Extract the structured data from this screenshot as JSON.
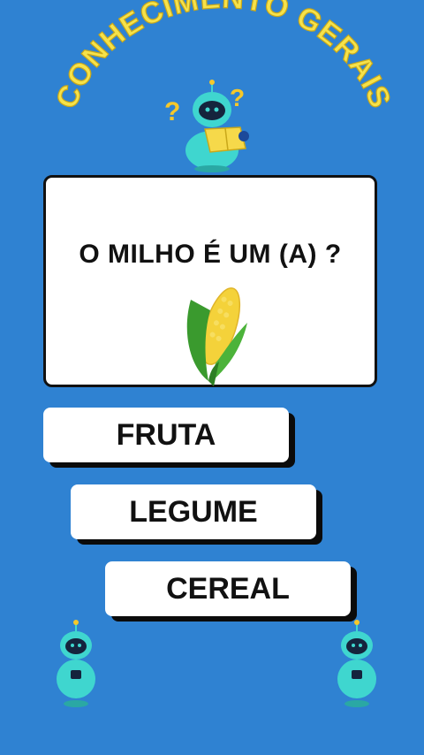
{
  "header": {
    "title": "CONHECIMENTO GERAIS"
  },
  "question": {
    "text": "O MILHO É  UM (A) ?"
  },
  "answers": [
    {
      "label": "FRUTA"
    },
    {
      "label": "LEGUME"
    },
    {
      "label": "CEREAL"
    }
  ],
  "colors": {
    "background": "#2f82d2",
    "title_fill": "#f6e24a",
    "robot": "#3fd6cf"
  },
  "icons": [
    "robot-reading-icon",
    "corn-icon",
    "robot-icon"
  ]
}
